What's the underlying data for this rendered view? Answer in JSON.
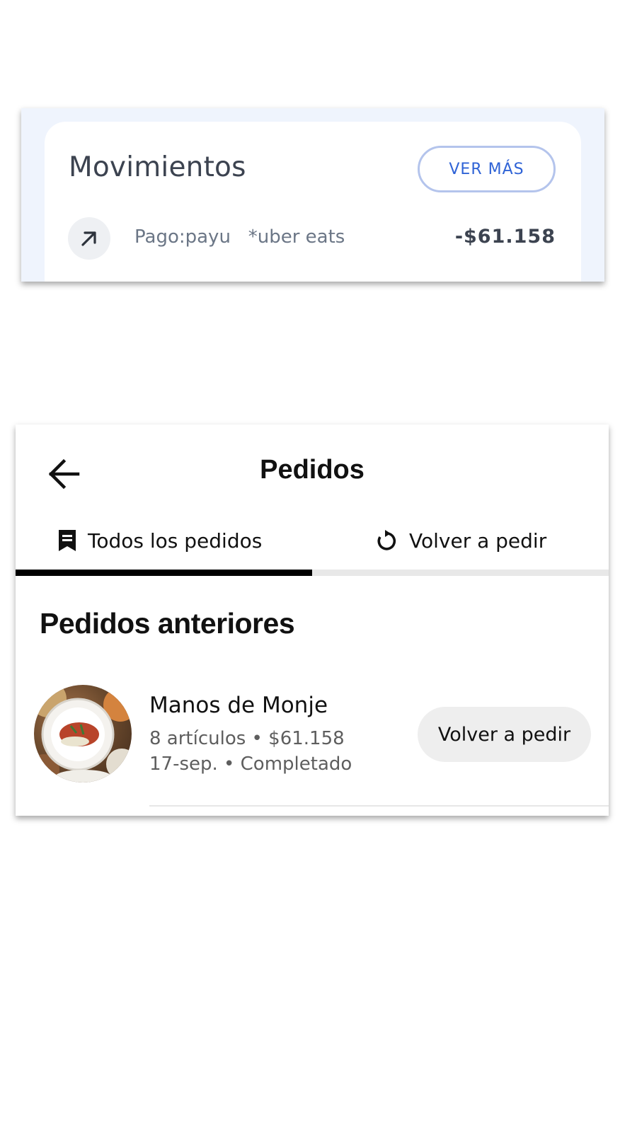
{
  "movimientos": {
    "title": "Movimientos",
    "ver_mas_label": "VER MÁS",
    "items": [
      {
        "icon": "arrow-up-right-icon",
        "description": "Pago:payu   *uber eats",
        "amount": "-$61.158"
      }
    ],
    "accent_color": "#2f63d6"
  },
  "pedidos": {
    "title": "Pedidos",
    "tabs": [
      {
        "label": "Todos los pedidos",
        "icon": "receipt-icon",
        "active": true
      },
      {
        "label": "Volver a pedir",
        "icon": "reorder-icon",
        "active": false
      }
    ],
    "section_title": "Pedidos anteriores",
    "orders": [
      {
        "restaurant": "Manos de Monje",
        "line1": "8 artículos • $61.158",
        "line2": "17-sep. • Completado",
        "action_label": "Volver a pedir",
        "thumbnail": "food-plate-image"
      }
    ]
  }
}
